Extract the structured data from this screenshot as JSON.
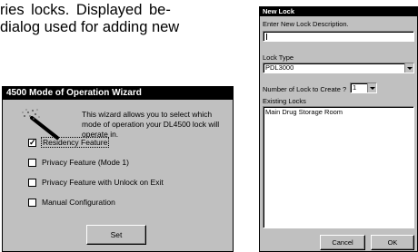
{
  "document": {
    "line1": "ries locks.  Displayed be-",
    "line2": "dialog used for adding new"
  },
  "wizard": {
    "title": "4500 Mode of Operation Wizard",
    "intro": "This wizard allows you to select which mode of operation your DL4500 lock will operate in.",
    "options": [
      {
        "label": "Residency Feature",
        "checked": true
      },
      {
        "label": "Privacy Feature (Mode 1)",
        "checked": false
      },
      {
        "label": "Privacy Feature with Unlock on Exit",
        "checked": false
      },
      {
        "label": "Manual Configuration",
        "checked": false
      }
    ],
    "set_label": "Set",
    "check_mark": "✓"
  },
  "new_lock": {
    "title": "New Lock",
    "description_label": "Enter New Lock Description.",
    "description_value": "",
    "lock_type_label": "Lock Type",
    "lock_type_value": "PDL3000",
    "count_label": "Number of Lock to Create ?",
    "count_value": "1",
    "existing_label": "Existing Locks",
    "existing_locks": [
      "Main Drug Storage Room"
    ],
    "cancel_label": "Cancel",
    "ok_label": "OK"
  }
}
